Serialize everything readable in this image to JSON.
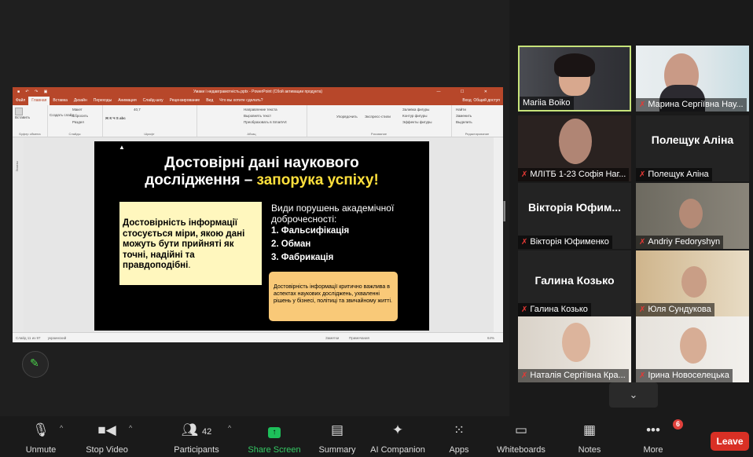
{
  "ppt": {
    "title": "Умаки і недавграмотність.pptx - PowerPoint (Сбой активации продукта)",
    "tabs": [
      "Файл",
      "Главная",
      "Вставка",
      "Дизайн",
      "Переходы",
      "Анимация",
      "Слайд-шоу",
      "Рецензирование",
      "Вид",
      "Что вы хотите сделать?"
    ],
    "active_tab": "Главная",
    "signin": "Вход",
    "share": "Общий доступ",
    "ribbon": {
      "paste": "Вставить",
      "clipboard": "Буфер обмена",
      "create_slide": "Создать слайд",
      "layout": "Макет",
      "reset": "Сбросить",
      "section": "Раздел",
      "slides": "Слайды",
      "font_size": "40,7",
      "font": "Шрифт",
      "paragraph": "Абзац",
      "text_dir": "Направление текста",
      "align_text": "Выровнять текст",
      "smartart": "Преобразовать в SmartArt",
      "arrange": "Упорядочить",
      "quick_styles": "Экспресс-стили",
      "fill": "Заливка фигуры",
      "outline": "Контур фигуры",
      "effects": "Эффекты фигуры",
      "drawing": "Рисование",
      "find": "Найти",
      "replace": "Заменить",
      "select": "Выделить",
      "editing": "Редактирование"
    },
    "thumb_label": "Эскизы",
    "status_left": "Слайд 11 из 97",
    "status_lang": "украинский",
    "status_notes": "Заметки",
    "status_comments": "Примечания",
    "zoom": "64%"
  },
  "slide": {
    "title_line1": "Достовірні дані наукового",
    "title_line2_white": "дослідження – ",
    "title_line2_yellow": "запорука успіху!",
    "yellow_text_bold": "Достовірність інформації стосується міри, якою дані можуть бути прийняті як точні, надійні та правдоподібні",
    "yellow_text_end": ".",
    "violations_heading": "Види порушень академічної доброчесності:",
    "violations": [
      "1.  Фальсифікація",
      "2.  Обман",
      "3.  Фабрикація"
    ],
    "orange_text": "Достовірність інформації критично важлива в аспектах наукових досліджень, ухваленні рішень у бізнесі, політиці та звичайному житті."
  },
  "participants": [
    {
      "name": "Mariia Boiko",
      "muted": false,
      "video": true
    },
    {
      "name": "Марина Сергіївна Нау...",
      "muted": true,
      "video": true
    },
    {
      "name": "МЛІТБ 1-23 Софія Наг...",
      "muted": true,
      "video": true
    },
    {
      "name": "Полещук Аліна",
      "big": "Полещук Аліна",
      "muted": true,
      "video": false
    },
    {
      "name": "Вікторія Юфименко",
      "big": "Вікторія Юфим...",
      "muted": true,
      "video": false
    },
    {
      "name": "Andriy Fedoryshyn",
      "muted": true,
      "video": true
    },
    {
      "name": "Галина Козько",
      "big": "Галина Козько",
      "muted": true,
      "video": false
    },
    {
      "name": "Юля Сундукова",
      "muted": true,
      "video": true
    },
    {
      "name": "Наталія Сергіївна Кра...",
      "muted": true,
      "video": true
    },
    {
      "name": "Ірина Новоселецька",
      "muted": true,
      "video": true
    }
  ],
  "toolbar": {
    "unmute": "Unmute",
    "stop_video": "Stop Video",
    "participants": "Participants",
    "participants_count": "42",
    "share_screen": "Share Screen",
    "summary": "Summary",
    "ai_companion": "AI Companion",
    "apps": "Apps",
    "whiteboards": "Whiteboards",
    "notes": "Notes",
    "more": "More",
    "more_badge": "6",
    "leave": "Leave"
  },
  "colors": {
    "ppt_accent": "#b7472a",
    "slide_yellow": "#ffe03c",
    "share_green": "#35c964",
    "leave_red": "#d93025",
    "active_speaker": "#c7e37a"
  }
}
